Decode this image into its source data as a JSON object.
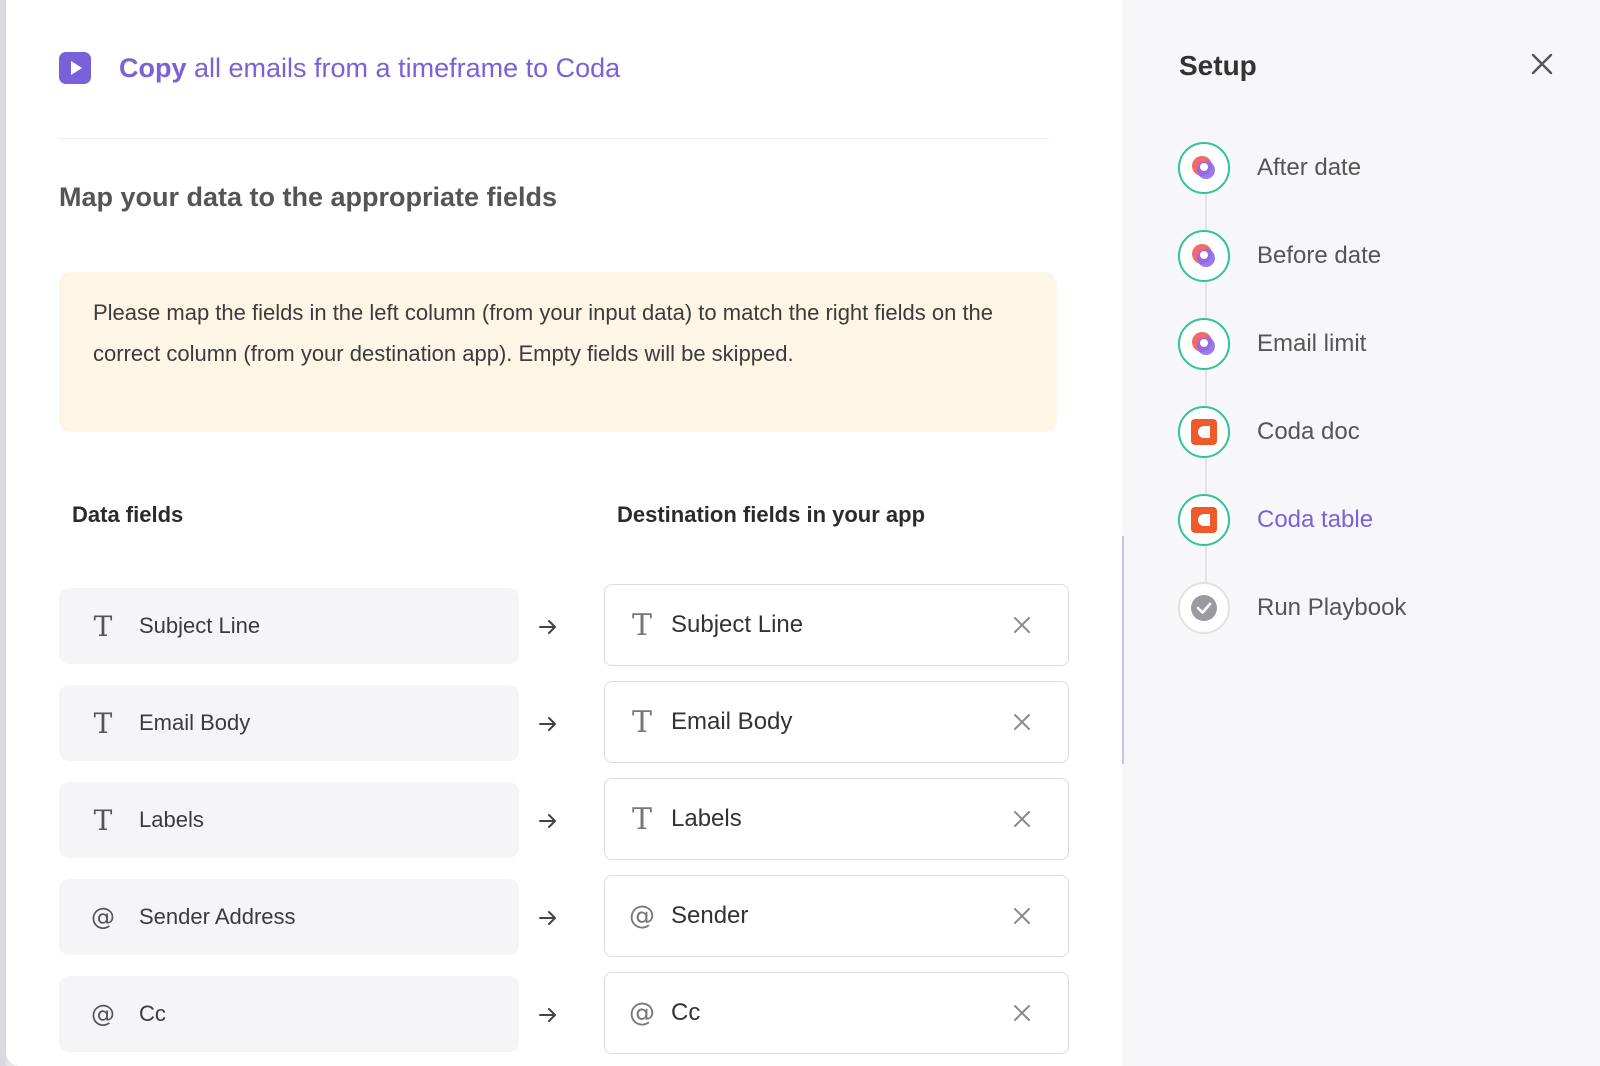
{
  "header": {
    "title_verb": "Copy",
    "title_rest": "all emails from a timeframe to Coda",
    "icon": "play-icon"
  },
  "section_title": "Map your data to the appropriate fields",
  "notice": "Please map the fields in the left column (from your input data) to match the right fields on the correct column (from your destination app). Empty fields will be skipped.",
  "columns": {
    "left": "Data fields",
    "right": "Destination fields in your app"
  },
  "mappings": [
    {
      "type_glyph": "T",
      "source": "Subject Line",
      "dest_type_glyph": "T",
      "destination": "Subject Line"
    },
    {
      "type_glyph": "T",
      "source": "Email Body",
      "dest_type_glyph": "T",
      "destination": "Email Body"
    },
    {
      "type_glyph": "T",
      "source": "Labels",
      "dest_type_glyph": "T",
      "destination": "Labels"
    },
    {
      "type_glyph": "@",
      "source": "Sender Address",
      "dest_type_glyph": "@",
      "destination": "Sender"
    },
    {
      "type_glyph": "@",
      "source": "Cc",
      "dest_type_glyph": "@",
      "destination": "Cc"
    }
  ],
  "sidebar": {
    "title": "Setup",
    "close_icon": "close-icon",
    "steps": [
      {
        "label": "After date",
        "icon": "gmail-app-icon",
        "state": "done"
      },
      {
        "label": "Before date",
        "icon": "gmail-app-icon",
        "state": "done"
      },
      {
        "label": "Email limit",
        "icon": "gmail-app-icon",
        "state": "done"
      },
      {
        "label": "Coda doc",
        "icon": "coda-app-icon",
        "state": "done"
      },
      {
        "label": "Coda table",
        "icon": "coda-app-icon",
        "state": "active"
      },
      {
        "label": "Run Playbook",
        "icon": "check-icon",
        "state": "pending"
      }
    ]
  },
  "colors": {
    "accent": "#7b61d9",
    "step_done_ring": "#2fc39c",
    "coda": "#ee5a29",
    "notice_bg": "#fdf5e6"
  }
}
